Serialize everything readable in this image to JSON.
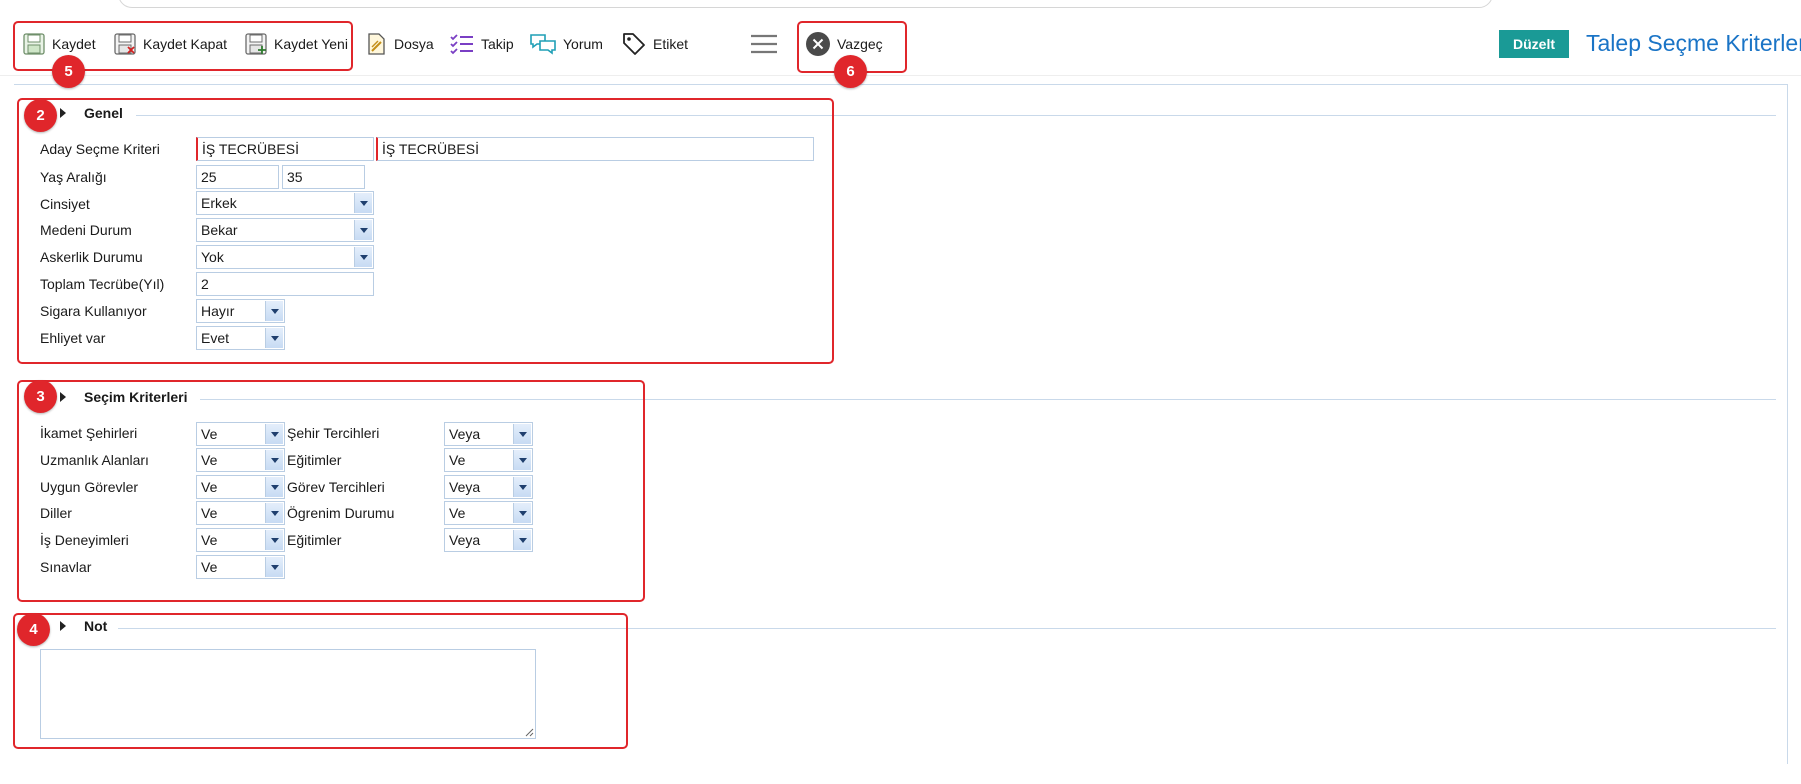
{
  "toolbar": {
    "kaydet": "Kaydet",
    "kaydet_kapat": "Kaydet Kapat",
    "kaydet_yeni": "Kaydet Yeni",
    "dosya": "Dosya",
    "takip": "Takip",
    "yorum": "Yorum",
    "etiket": "Etiket",
    "vazgec": "Vazgeç",
    "duzelt": "Düzelt"
  },
  "page_title": "Talep Seçme Kriterleri",
  "badges": {
    "b2": "2",
    "b3": "3",
    "b4": "4",
    "b5": "5",
    "b6": "6"
  },
  "genel": {
    "title": "Genel",
    "labels": {
      "aday": "Aday Seçme Kriteri",
      "yas": "Yaş Aralığı",
      "cinsiyet": "Cinsiyet",
      "medeni": "Medeni Durum",
      "askerlik": "Askerlik Durumu",
      "tecrube": "Toplam Tecrübe(Yıl)",
      "sigara": "Sigara Kullanıyor",
      "ehliyet": "Ehliyet var"
    },
    "values": {
      "aday_code": "İŞ TECRÜBESİ",
      "aday_name": "İŞ TECRÜBESİ",
      "yas_min": "25",
      "yas_max": "35",
      "cinsiyet": "Erkek",
      "medeni": "Bekar",
      "askerlik": "Yok",
      "tecrube": "2",
      "sigara": "Hayır",
      "ehliyet": "Evet"
    }
  },
  "secim": {
    "title": "Seçim Kriterleri",
    "left": [
      {
        "label": "İkamet Şehirleri",
        "value": "Ve"
      },
      {
        "label": "Uzmanlık Alanları",
        "value": "Ve"
      },
      {
        "label": "Uygun Görevler",
        "value": "Ve"
      },
      {
        "label": "Diller",
        "value": "Ve"
      },
      {
        "label": "İş Deneyimleri",
        "value": "Ve"
      },
      {
        "label": "Sınavlar",
        "value": "Ve"
      }
    ],
    "right": [
      {
        "label": "Şehir Tercihleri",
        "value": "Veya"
      },
      {
        "label": "Eğitimler",
        "value": "Ve"
      },
      {
        "label": "Görev Tercihleri",
        "value": "Veya"
      },
      {
        "label": "Ögrenim Durumu",
        "value": "Ve"
      },
      {
        "label": "Eğitimler",
        "value": "Veya"
      }
    ]
  },
  "not": {
    "title": "Not",
    "value": ""
  }
}
